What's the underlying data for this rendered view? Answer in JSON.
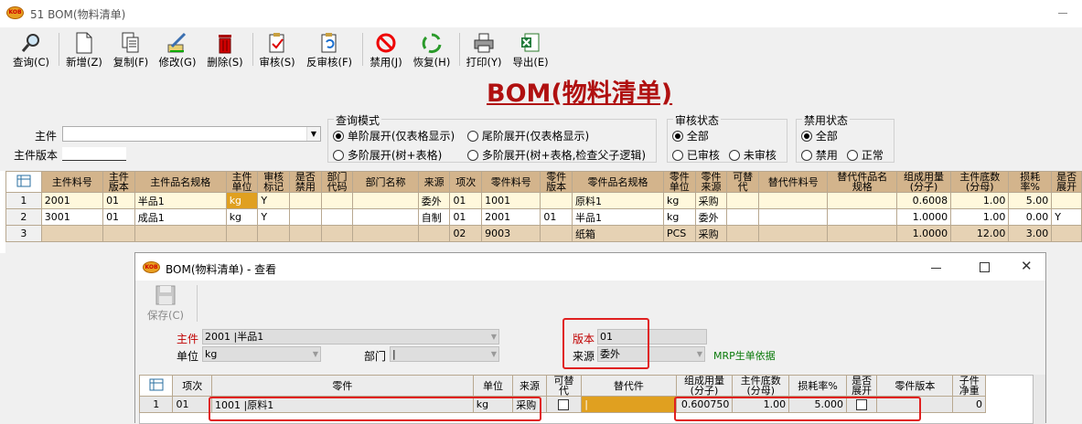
{
  "window": {
    "title": "51 BOM(物料清单)",
    "logo": "KOB"
  },
  "toolbar": [
    {
      "label": "查询(C)",
      "icon": "search-icon"
    },
    {
      "label": "新增(Z)",
      "icon": "new-doc-icon"
    },
    {
      "label": "复制(F)",
      "icon": "copy-icon"
    },
    {
      "label": "修改(G)",
      "icon": "edit-icon"
    },
    {
      "label": "删除(S)",
      "icon": "delete-icon"
    },
    {
      "label": "审核(S)",
      "icon": "approve-icon"
    },
    {
      "label": "反审核(F)",
      "icon": "unapprove-icon"
    },
    {
      "label": "禁用(J)",
      "icon": "disable-icon"
    },
    {
      "label": "恢复(H)",
      "icon": "restore-icon"
    },
    {
      "label": "打印(Y)",
      "icon": "print-icon"
    },
    {
      "label": "导出(E)",
      "icon": "excel-export-icon"
    }
  ],
  "page_title": "BOM(物料清单)",
  "filters": {
    "main_item_label": "主件",
    "main_item_value": "",
    "main_version_label": "主件版本",
    "main_version_value": "",
    "query_mode": {
      "title": "查询模式",
      "options": [
        "单阶展开(仅表格显示)",
        "尾阶展开(仅表格显示)",
        "多阶展开(树+表格)",
        "多阶展开(树+表格,检查父子逻辑)"
      ],
      "selected": 0
    },
    "review_status": {
      "title": "审核状态",
      "options": [
        "全部",
        "已审核",
        "未审核"
      ],
      "selected": 0
    },
    "disable_status": {
      "title": "禁用状态",
      "options": [
        "全部",
        "禁用",
        "正常"
      ],
      "selected": 0
    }
  },
  "main_table": {
    "headers": [
      "主件料号",
      "主件\n版本",
      "主件品名规格",
      "主件\n单位",
      "审核\n标记",
      "是否\n禁用",
      "部门\n代码",
      "部门名称",
      "来源",
      "项次",
      "零件料号",
      "零件\n版本",
      "零件品名规格",
      "零件\n单位",
      "零件\n来源",
      "可替\n代",
      "替代件料号",
      "替代件品名\n规格",
      "组成用量\n(分子)",
      "主件底数\n(分母)",
      "损耗\n率%",
      "是否\n展开"
    ],
    "rows": [
      [
        "1",
        "2001",
        "01",
        "半品1",
        "kg",
        "Y",
        "",
        "",
        "",
        "委外",
        "01",
        "1001",
        "",
        "原料1",
        "kg",
        "采购",
        "",
        "",
        "",
        "0.6008",
        "1.00",
        "5.00",
        ""
      ],
      [
        "2",
        "3001",
        "01",
        "成品1",
        "kg",
        "Y",
        "",
        "",
        "",
        "自制",
        "01",
        "2001",
        "01",
        "半品1",
        "kg",
        "委外",
        "",
        "",
        "",
        "1.0000",
        "1.00",
        "0.00",
        "Y"
      ],
      [
        "3",
        "",
        "",
        "",
        "",
        "",
        "",
        "",
        "",
        "",
        "02",
        "9003",
        "",
        "纸箱",
        "PCS",
        "采购",
        "",
        "",
        "",
        "1.0000",
        "12.00",
        "3.00",
        ""
      ]
    ]
  },
  "dialog": {
    "title": "BOM(物料清单) - 查看",
    "save_label": "保存(C)",
    "main_item_label": "主件",
    "main_item_value": "2001 |半品1",
    "unit_label": "单位",
    "unit_value": "kg",
    "dept_label": "部门",
    "dept_value": "|",
    "version_label": "版本",
    "version_value": "01",
    "source_label": "来源",
    "source_value": "委外",
    "mrp_note": "MRP生单依据",
    "grid_headers": [
      "项次",
      "零件",
      "单位",
      "来源",
      "可替\n代",
      "替代件",
      "组成用量\n(分子)",
      "主件底数\n(分母)",
      "损耗率%",
      "是否\n展开",
      "零件版本",
      "子件\n净重"
    ],
    "grid_row": {
      "no": "1",
      "seq": "01",
      "part": "1001 |原料1",
      "unit": "kg",
      "source": "采购",
      "alt": "|",
      "qty": "0.600750",
      "base": "1.00",
      "loss": "5.000",
      "version": "",
      "net": "0"
    }
  },
  "colors": {
    "title_red": "#b01010",
    "header_tan": "#d3b48c",
    "row_yellow": "#fff8dc",
    "highlight_red": "#e02020",
    "orange_cell": "#e0a020"
  }
}
